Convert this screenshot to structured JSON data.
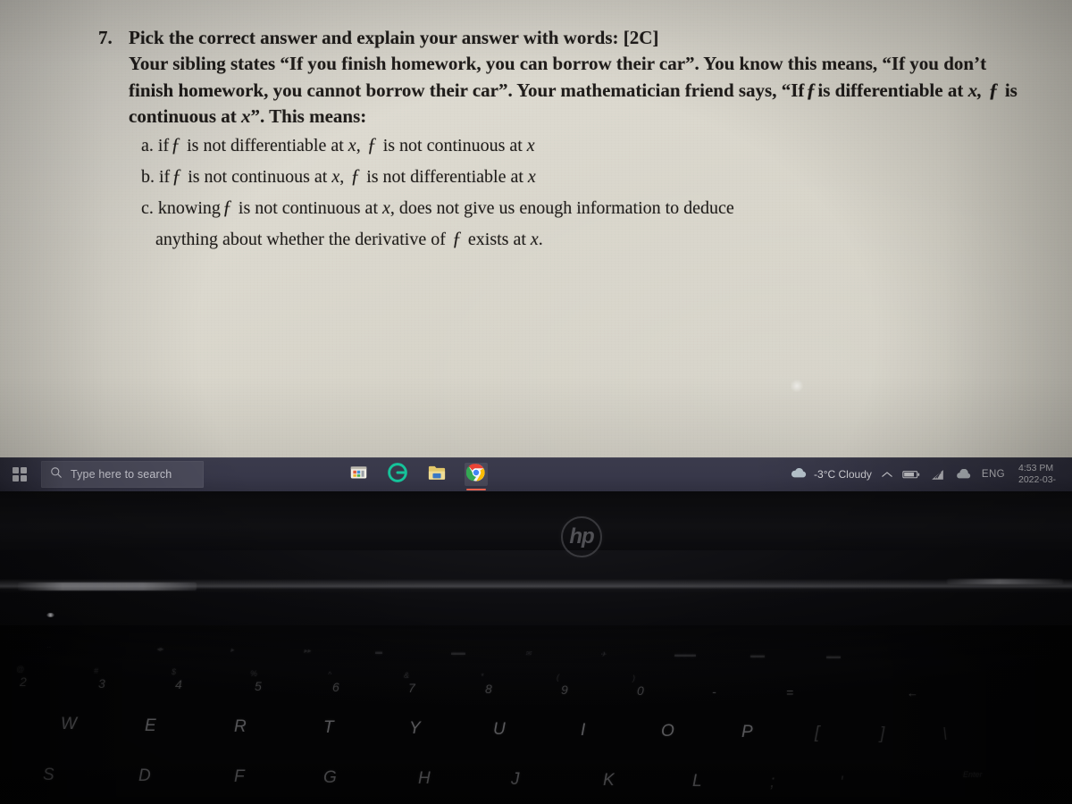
{
  "document": {
    "question_number": "7.",
    "heading": "Pick the correct answer and explain your answer with words: [2C]",
    "body_line1": "Your sibling states “If you finish homework, you can borrow their car”. You know this means, “If you don’t",
    "body_line2_a": "finish homework, you cannot borrow their car”. Your mathematician friend says, “If",
    "body_line2_f": "ƒ",
    "body_line2_b": "is differentiable at",
    "body_line2_x": "x,",
    "body_line2_f2": "ƒ",
    "body_line2_c": "is",
    "body_line3_a": "continuous at",
    "body_line3_x": "x",
    "body_line3_b": "”. This means:",
    "options": [
      {
        "label": "a.",
        "seg1": "if",
        "f1": "ƒ",
        "seg2": "is not differentiable at",
        "x1": "x",
        "seg3": ",",
        "f2": "ƒ",
        "seg4": "is not continuous at",
        "x2": "x"
      },
      {
        "label": "b.",
        "seg1": "if",
        "f1": "ƒ",
        "seg2": "is not continuous at",
        "x1": "x",
        "seg3": ",",
        "f2": "ƒ",
        "seg4": "is not differentiable at",
        "x2": "x"
      },
      {
        "label": "c.",
        "seg1": "knowing",
        "f1": "ƒ",
        "seg2": "is not continuous at",
        "x1": "x",
        "seg3": ", does not give us enough information to deduce",
        "f2": "",
        "seg4": "",
        "x2": ""
      }
    ],
    "option_c_line2_a": "anything about whether the derivative of",
    "option_c_line2_f": "ƒ",
    "option_c_line2_b": "exists at",
    "option_c_line2_x": "x",
    "option_c_line2_c": "."
  },
  "taskbar": {
    "start_label": "Start",
    "search": {
      "placeholder": "Type here to search",
      "value": ""
    },
    "pinned_apps": [
      {
        "name": "microsoft-store",
        "label": "Microsoft Store"
      },
      {
        "name": "grammarly",
        "label": "Grammarly"
      },
      {
        "name": "file-explorer",
        "label": "File Explorer"
      },
      {
        "name": "google-chrome",
        "label": "Google Chrome"
      }
    ],
    "tray": {
      "weather_temp": "-3°C",
      "weather_condition": "Cloudy",
      "weather_full": "-3°C  Cloudy",
      "show_hidden_label": "Show hidden icons",
      "battery_label": "Battery",
      "network_label": "Network",
      "onedrive_label": "OneDrive",
      "language": "ENG",
      "time": "4:53 PM",
      "date": "2022-03-"
    }
  },
  "laptop": {
    "brand": "hp",
    "keyboard": {
      "fn_row": [
        "··",
        "◂▸",
        "▸",
        "▸▸",
        "▬",
        "▬▬",
        "✉",
        "✈",
        "▬▬▬",
        "▬▬",
        "▬▬"
      ],
      "number_row": [
        "2",
        "3",
        "4",
        "5",
        "6",
        "7",
        "8",
        "9",
        "0",
        "-",
        "="
      ],
      "number_row_shift": [
        "@",
        "#",
        "$",
        "%",
        "^",
        "&",
        "*",
        "(",
        ")",
        "_",
        "+"
      ],
      "qwerty_row": [
        "W",
        "E",
        "R",
        "T",
        "Y",
        "U",
        "I",
        "O",
        "P",
        "[",
        "]",
        "\\"
      ],
      "home_row": [
        "S",
        "D",
        "F",
        "G",
        "H",
        "J",
        "K",
        "L",
        ";",
        "'",
        "Enter"
      ],
      "backspace_label": "←"
    }
  },
  "colors": {
    "paper": "#dcd9cf",
    "ink": "#201d1b",
    "taskbar": "#38384a",
    "search_box": "#4b4b5b",
    "chrome_accent": "#e8604c",
    "grammarly": "#15c39a",
    "key_text": "#cdcdd2"
  }
}
